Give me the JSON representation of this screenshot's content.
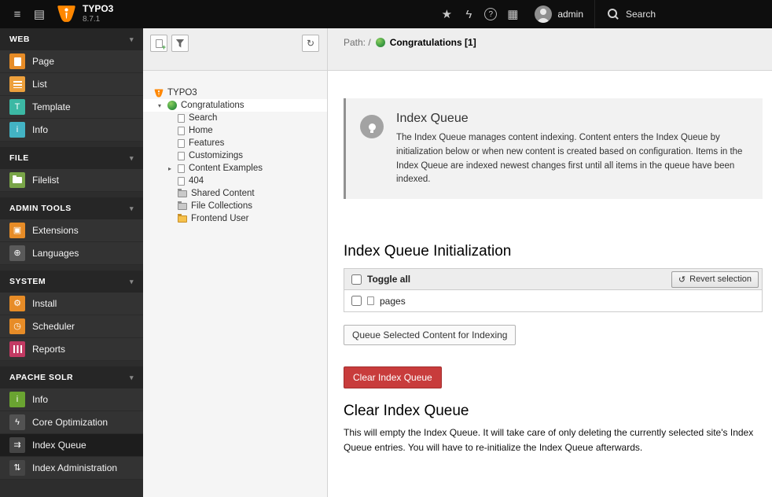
{
  "topbar": {
    "brand": {
      "name": "TYPO3",
      "version": "8.7.1"
    },
    "user": {
      "name": "admin"
    },
    "search": {
      "label": "Search"
    }
  },
  "sidebar": {
    "sections": [
      {
        "label": "WEB",
        "items": [
          {
            "label": "Page"
          },
          {
            "label": "List"
          },
          {
            "label": "Template"
          },
          {
            "label": "Info"
          }
        ]
      },
      {
        "label": "FILE",
        "items": [
          {
            "label": "Filelist"
          }
        ]
      },
      {
        "label": "ADMIN TOOLS",
        "items": [
          {
            "label": "Extensions"
          },
          {
            "label": "Languages"
          }
        ]
      },
      {
        "label": "SYSTEM",
        "items": [
          {
            "label": "Install"
          },
          {
            "label": "Scheduler"
          },
          {
            "label": "Reports"
          }
        ]
      },
      {
        "label": "APACHE SOLR",
        "items": [
          {
            "label": "Info"
          },
          {
            "label": "Core Optimization"
          },
          {
            "label": "Index Queue",
            "active": true
          },
          {
            "label": "Index Administration"
          }
        ]
      }
    ]
  },
  "pagetree": {
    "root_label": "TYPO3",
    "nodes": [
      {
        "label": "Congratulations",
        "selected": true
      },
      {
        "label": "Search"
      },
      {
        "label": "Home"
      },
      {
        "label": "Features"
      },
      {
        "label": "Customizings"
      },
      {
        "label": "Content Examples"
      },
      {
        "label": "404"
      },
      {
        "label": "Shared Content"
      },
      {
        "label": "File Collections"
      },
      {
        "label": "Frontend User"
      }
    ]
  },
  "docheader": {
    "path_label": "Path: /",
    "record_title": "Congratulations [1]"
  },
  "content": {
    "callout": {
      "title": "Index Queue",
      "body": "The Index Queue manages content indexing. Content enters the Index Queue by initialization below or when new content is created based on configuration. Items in the Index Queue are indexed newest changes first until all items in the queue have been indexed."
    },
    "initialization": {
      "heading": "Index Queue Initialization",
      "toggle_all": "Toggle all",
      "revert_button": "Revert selection",
      "types": [
        "pages"
      ],
      "queue_button": "Queue Selected Content for Indexing"
    },
    "clear": {
      "button": "Clear Index Queue",
      "heading": "Clear Index Queue",
      "body": "This will empty the Index Queue. It will take care of only deleting the currently selected site's Index Queue entries. You will have to re-initialize the Index Queue afterwards."
    }
  },
  "icons": {
    "hamburger": "≡",
    "list_menu": "▤",
    "star": "★",
    "bolt": "ϟ",
    "help": "?",
    "grid": "▦",
    "chevron_down": "▾",
    "tree_down": "▾",
    "tree_right": "▸",
    "refresh": "↻",
    "revert": "↺",
    "plus": "+",
    "template_t": "T",
    "info_i": "i",
    "grid_box": "▣",
    "globe": "⊕",
    "gear": "⚙",
    "clock": "◷",
    "lightning": "ϟ",
    "queue_arrows": "⇉",
    "sliders": "⇅"
  },
  "colors": {
    "brand_orange": "#ff8700",
    "danger": "#c83c3c",
    "topbar_bg": "#0e0e0e",
    "active_module_bg": "#1d1d1d"
  }
}
